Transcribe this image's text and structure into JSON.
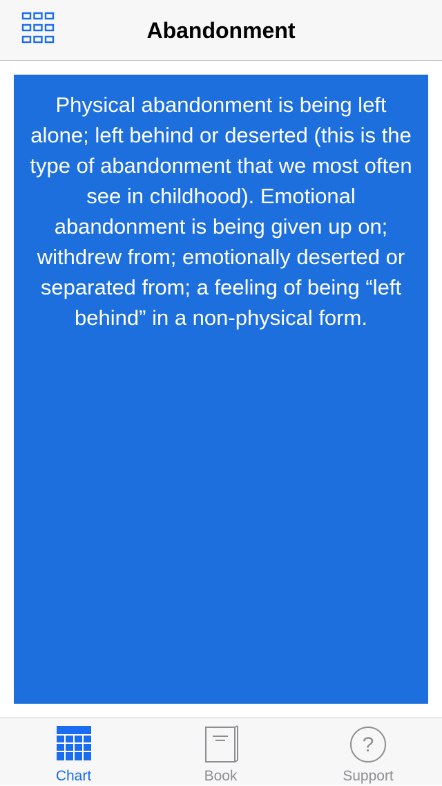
{
  "nav": {
    "title": "Abandonment",
    "menu_icon": "grid-menu-icon"
  },
  "card": {
    "background": "#1d6fde",
    "text": "Physical abandonment is being left alone; left behind or deserted (this is the type of abandonment that we most often see in childhood). Emotional abandonment is being given up on; withdrew from; emotionally deserted or separated from; a feeling of being “left behind” in a non-physical form."
  },
  "tabs": [
    {
      "label": "Chart",
      "icon": "chart-grid-icon",
      "selected": true
    },
    {
      "label": "Book",
      "icon": "book-icon",
      "selected": false
    },
    {
      "label": "Support",
      "icon": "question-mark-icon",
      "selected": false
    }
  ],
  "colors": {
    "accent": "#1a6cf0",
    "inactive": "#8e8e93"
  }
}
